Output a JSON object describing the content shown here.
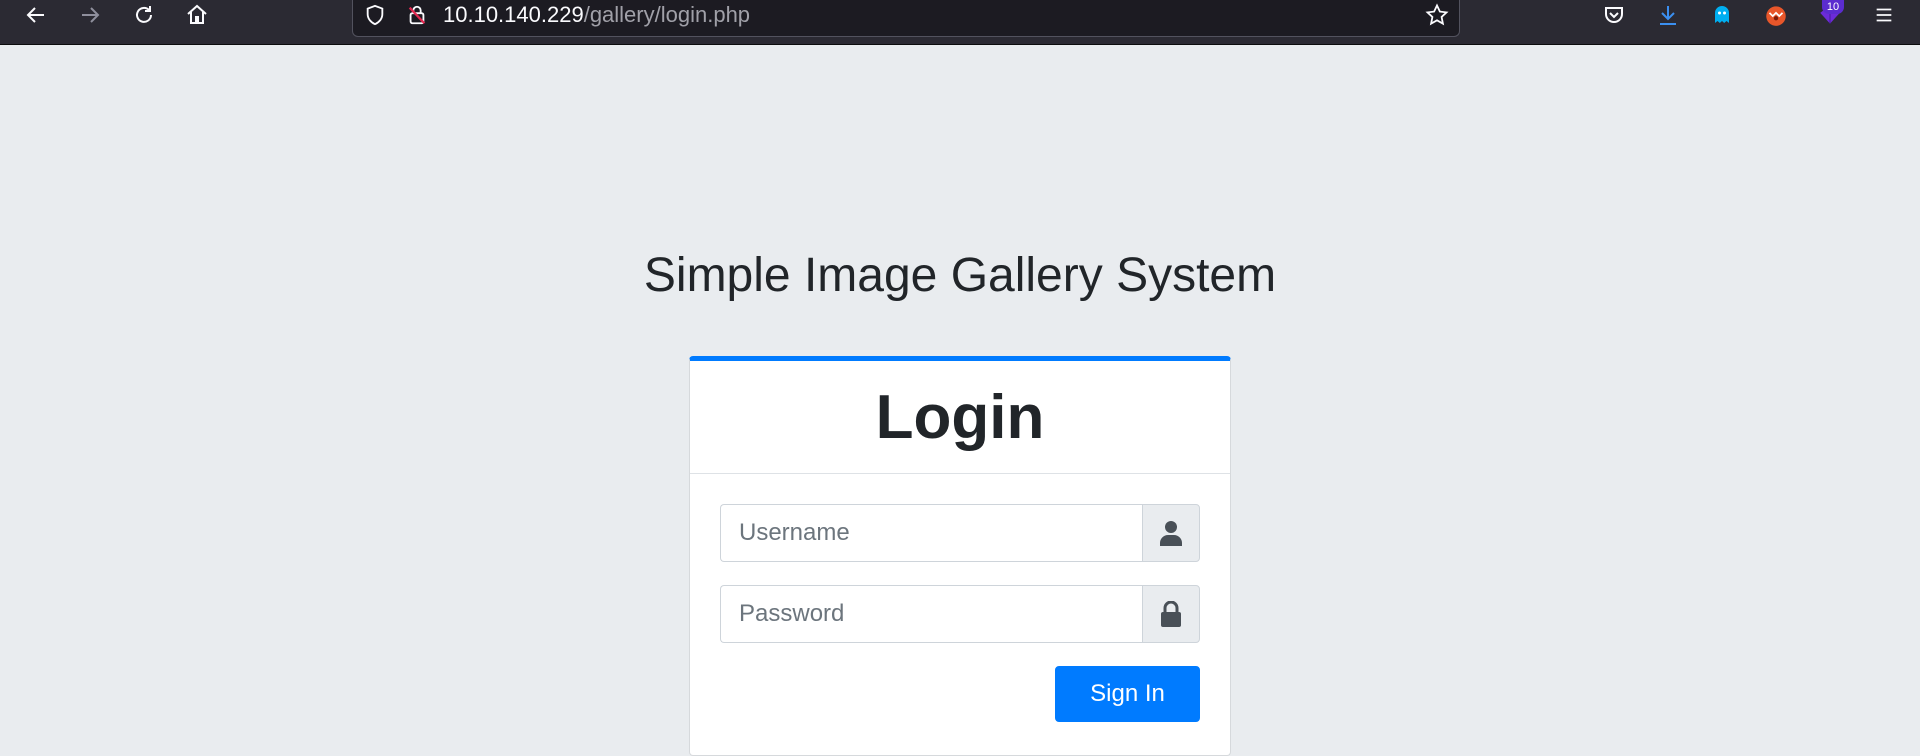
{
  "browser": {
    "url_host": "10.10.140.229",
    "url_path": "/gallery/login.php",
    "extension_badge": "10",
    "icons": [
      "back-icon",
      "forward-icon",
      "reload-icon",
      "home-icon",
      "shield-icon",
      "insecure-lock-icon",
      "bookmark-star-icon",
      "pocket-icon",
      "downloads-icon",
      "ghostery-icon",
      "fox-extension-icon",
      "extension-icon",
      "menu-icon"
    ]
  },
  "page": {
    "title": "Simple Image Gallery System"
  },
  "login": {
    "heading": "Login",
    "username_placeholder": "Username",
    "password_placeholder": "Password",
    "submit_label": "Sign In",
    "accent_color": "#007bff"
  }
}
